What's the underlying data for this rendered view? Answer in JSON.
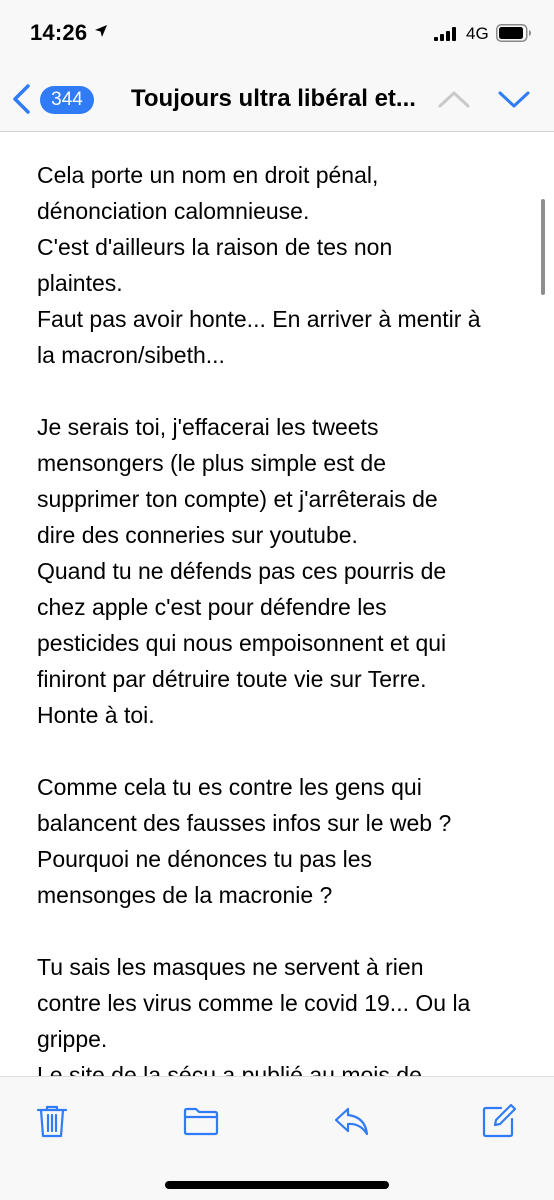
{
  "status_bar": {
    "time": "14:26",
    "network": "4G",
    "icons": [
      "location-arrow-icon",
      "signal-icon",
      "battery-icon"
    ]
  },
  "nav": {
    "back_count": "344",
    "subject": "Toujours ultra libéral et...",
    "accent_color": "#2f7cf6",
    "icons": [
      "chevron-left-icon",
      "chevron-up-icon",
      "chevron-down-icon"
    ]
  },
  "message": {
    "paragraphs": [
      {
        "lines": [
          "Cela porte un nom en droit pénal,",
          "dénonciation calomnieuse.",
          "C'est d'ailleurs la raison de tes non",
          "plaintes.",
          "Faut pas avoir honte... En arriver à mentir à",
          "la macron/sibeth..."
        ]
      },
      {
        "lines": [
          "Je serais toi, j'effacerai les tweets",
          "mensongers (le plus simple est de",
          "supprimer ton compte) et j'arrêterais de",
          "dire des conneries sur youtube.",
          "Quand tu ne défends pas ces pourris de",
          "chez apple c'est pour défendre les",
          "pesticides qui nous empoisonnent et qui",
          "finiront par détruire toute vie sur Terre.",
          "Honte à toi."
        ]
      },
      {
        "lines": [
          "Comme cela tu es contre les gens qui",
          "balancent des fausses infos sur le web ?",
          "Pourquoi ne dénonces tu pas les",
          "mensonges de la macronie ?"
        ]
      },
      {
        "lines": [
          "Tu sais les masques ne servent à rien",
          "contre les virus comme le covid 19... Ou la",
          "grippe.",
          "Le site de la sécu a publié au mois de"
        ]
      }
    ]
  },
  "toolbar": {
    "icons": [
      "trash-icon",
      "folder-icon",
      "reply-icon",
      "compose-icon"
    ]
  }
}
